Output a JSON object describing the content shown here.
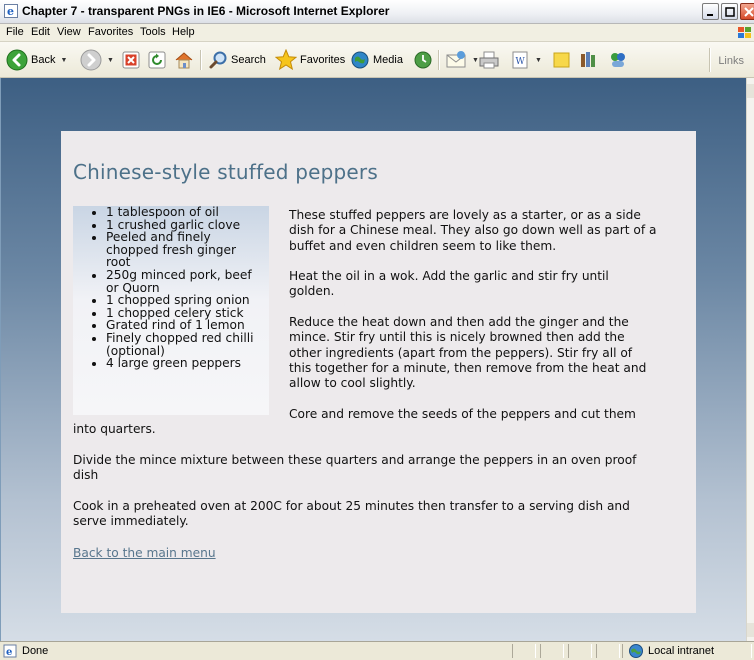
{
  "window": {
    "title": "Chapter 7 - transparent PNGs in IE6 - Microsoft Internet Explorer"
  },
  "menu": [
    "File",
    "Edit",
    "View",
    "Favorites",
    "Tools",
    "Help"
  ],
  "toolbar": {
    "back": "Back",
    "search": "Search",
    "favorites": "Favorites",
    "media": "Media",
    "links": "Links"
  },
  "page": {
    "heading": "Chinese-style stuffed peppers",
    "ingredients": [
      "1 tablespoon of oil",
      "1 crushed garlic clove",
      "Peeled and finely chopped fresh ginger root",
      "250g minced pork, beef or Quorn",
      "1 chopped spring onion",
      "1 chopped celery stick",
      "Grated rind of 1 lemon",
      "Finely chopped red chilli (optional)",
      "4 large green peppers"
    ],
    "paragraphs": [
      "These stuffed peppers are lovely as a starter, or as a side dish for a Chinese meal. They also go down well as part of a buffet and even children seem to like them.",
      "Heat the oil in a wok. Add the garlic and stir fry until golden.",
      "Reduce the heat down and then add the ginger and the mince. Stir fry until this is nicely browned then add the other ingredients (apart from the peppers). Stir fry all of this together for a minute, then remove from the heat and allow to cool slightly.",
      "Core and remove the seeds of the peppers and cut them into quarters.",
      "Divide the mince mixture between these quarters and arrange the peppers in an oven proof dish",
      "Cook in a preheated oven at 200C for about 25 minutes then transfer to a serving dish and serve immediately."
    ],
    "back_link": "Back to the main menu"
  },
  "status": {
    "text": "Done",
    "zone": "Local intranet"
  }
}
